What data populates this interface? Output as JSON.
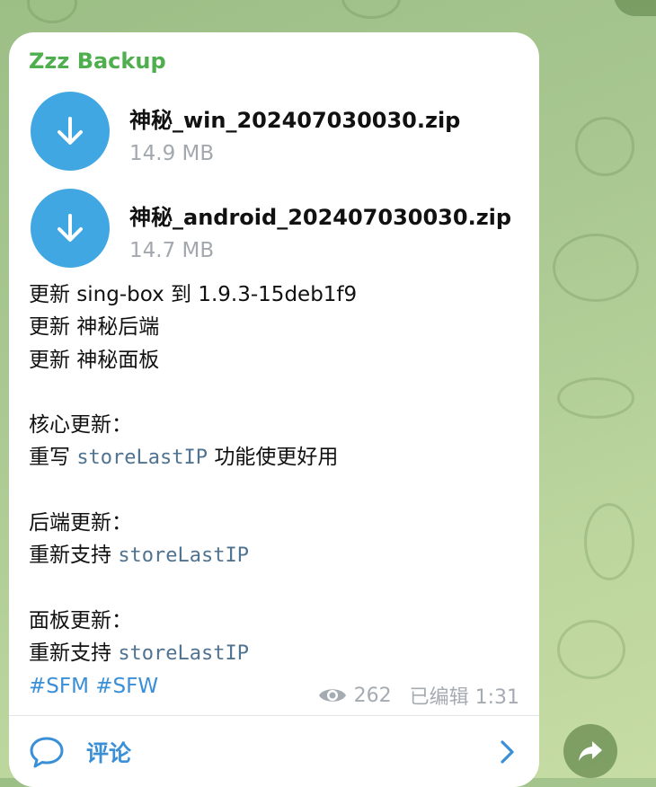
{
  "message": {
    "sender": "Zzz Backup",
    "files": [
      {
        "name": "神秘_win_202407030030.zip",
        "size": "14.9 MB",
        "icon": "download-icon"
      },
      {
        "name": "神秘_android_202407030030.zip",
        "size": "14.7 MB",
        "icon": "download-icon"
      }
    ],
    "lines": {
      "l1": "更新 sing-box 到 1.9.3-15deb1f9",
      "l2": "更新 神秘后端",
      "l3": "更新 神秘面板",
      "core_heading": "核心更新：",
      "core_prefix": "重写 ",
      "core_code": "storeLastIP",
      "core_suffix": " 功能使更好用",
      "backend_heading": "后端更新：",
      "backend_prefix": "重新支持 ",
      "backend_code": "storeLastIP",
      "panel_heading": "面板更新：",
      "panel_prefix": "重新支持 ",
      "panel_code": "storeLastIP",
      "hashtag1": "#SFM",
      "hashtag2": "#SFW"
    },
    "views": "262",
    "edited": "已编辑 1:31",
    "comments_label": "评论"
  },
  "colors": {
    "accent": "#40a7e3",
    "sender": "#4fae4e",
    "link": "#3a8fd6",
    "code": "#4f7391",
    "meta": "#a5abb2",
    "background": "#aac892"
  },
  "icons": {
    "views": "eye-icon",
    "comments": "chat-bubble-icon",
    "chevron": "chevron-right-icon",
    "share": "share-arrow-icon"
  }
}
